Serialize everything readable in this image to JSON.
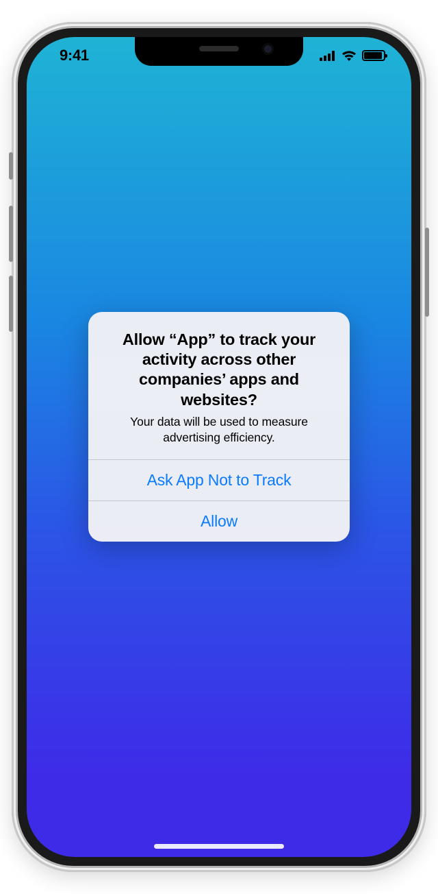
{
  "status": {
    "time": "9:41"
  },
  "alert": {
    "title": "Allow “App” to track your activity across other companies’ apps and websites?",
    "subtitle": "Your data will be used to measure advertising efficiency.",
    "deny_label": "Ask App Not to Track",
    "allow_label": "Allow"
  },
  "colors": {
    "action": "#0a7aff"
  }
}
